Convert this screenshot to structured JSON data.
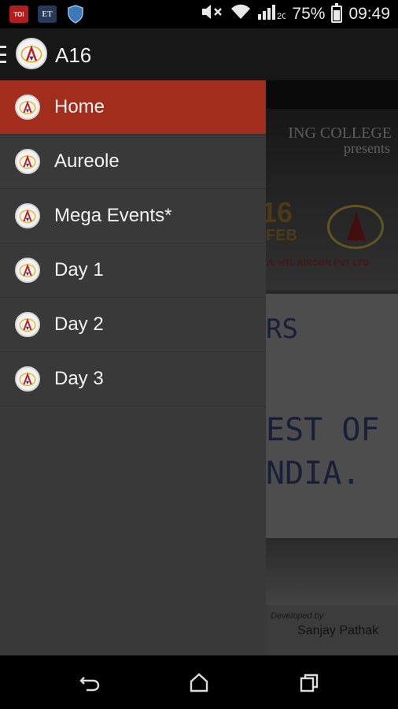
{
  "status_bar": {
    "notifications": [
      "TOI",
      "ET",
      "shield-icon"
    ],
    "battery": "75%",
    "battery_level": 0.75,
    "time": "09:49",
    "icons": [
      "volume-muted-icon",
      "wifi-icon",
      "signal-icon",
      "battery-icon"
    ]
  },
  "app_bar": {
    "title": "A16",
    "icon": "menu-icon"
  },
  "drawer": {
    "items": [
      {
        "label": "Home",
        "active": true
      },
      {
        "label": "Aureole",
        "active": false
      },
      {
        "label": "Mega Events*",
        "active": false
      },
      {
        "label": "Day 1",
        "active": false
      },
      {
        "label": "Day 2",
        "active": false
      },
      {
        "label": "Day 3",
        "active": false
      }
    ]
  },
  "background_poster": {
    "college": "ING COLLEGE",
    "presents": "presents",
    "date": "16",
    "month": "FEB",
    "sponsors": "7L HTL AIRCON PVT LTD",
    "board_line1": "RS",
    "board_line2": "EST OF",
    "board_line3": "NDIA.",
    "developed_by": "Developed by",
    "developer": "Sanjay Pathak"
  },
  "nav_bar": {
    "buttons": [
      "back-icon",
      "home-icon",
      "recents-icon"
    ]
  },
  "colors": {
    "accent": "#a32d1c",
    "drawer_bg": "#393939",
    "app_bar_bg": "#2b2b2b"
  }
}
